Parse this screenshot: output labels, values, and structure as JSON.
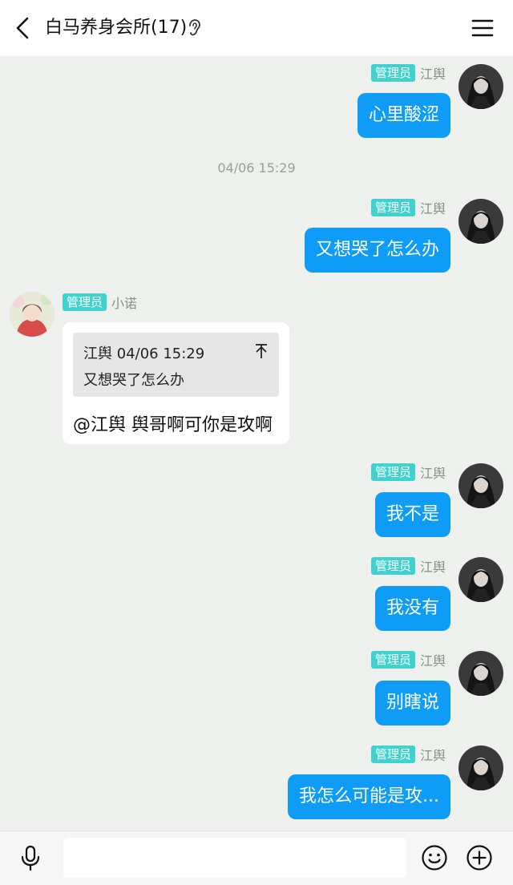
{
  "header": {
    "title": "白马养身会所(17)",
    "back_icon": "chevron-left-icon",
    "ear_icon": "ear-icon",
    "menu_icon": "menu-icon"
  },
  "messages": [
    {
      "badge": "管理员",
      "sender": "江舆",
      "text": "心里酸涩"
    },
    {
      "timestamp": "04/06 15:29"
    },
    {
      "badge": "管理员",
      "sender": "江舆",
      "text": "又想哭了怎么办"
    },
    {
      "badge": "管理员",
      "sender": "小诺",
      "quote": {
        "header": "江舆 04/06 15:29",
        "text": "又想哭了怎么办"
      },
      "text": "@江舆 舆哥啊可你是攻啊"
    },
    {
      "badge": "管理员",
      "sender": "江舆",
      "text": "我不是"
    },
    {
      "badge": "管理员",
      "sender": "江舆",
      "text": "我没有"
    },
    {
      "badge": "管理员",
      "sender": "江舆",
      "text": "别瞎说"
    },
    {
      "badge": "管理员",
      "sender": "江舆",
      "text": "我怎么可能是攻..."
    }
  ],
  "input": {
    "value": "",
    "placeholder": ""
  },
  "colors": {
    "chat_bg": "#edf0ed",
    "out_bubble": "#0f9cf7",
    "badge": "#3fd2cf"
  }
}
